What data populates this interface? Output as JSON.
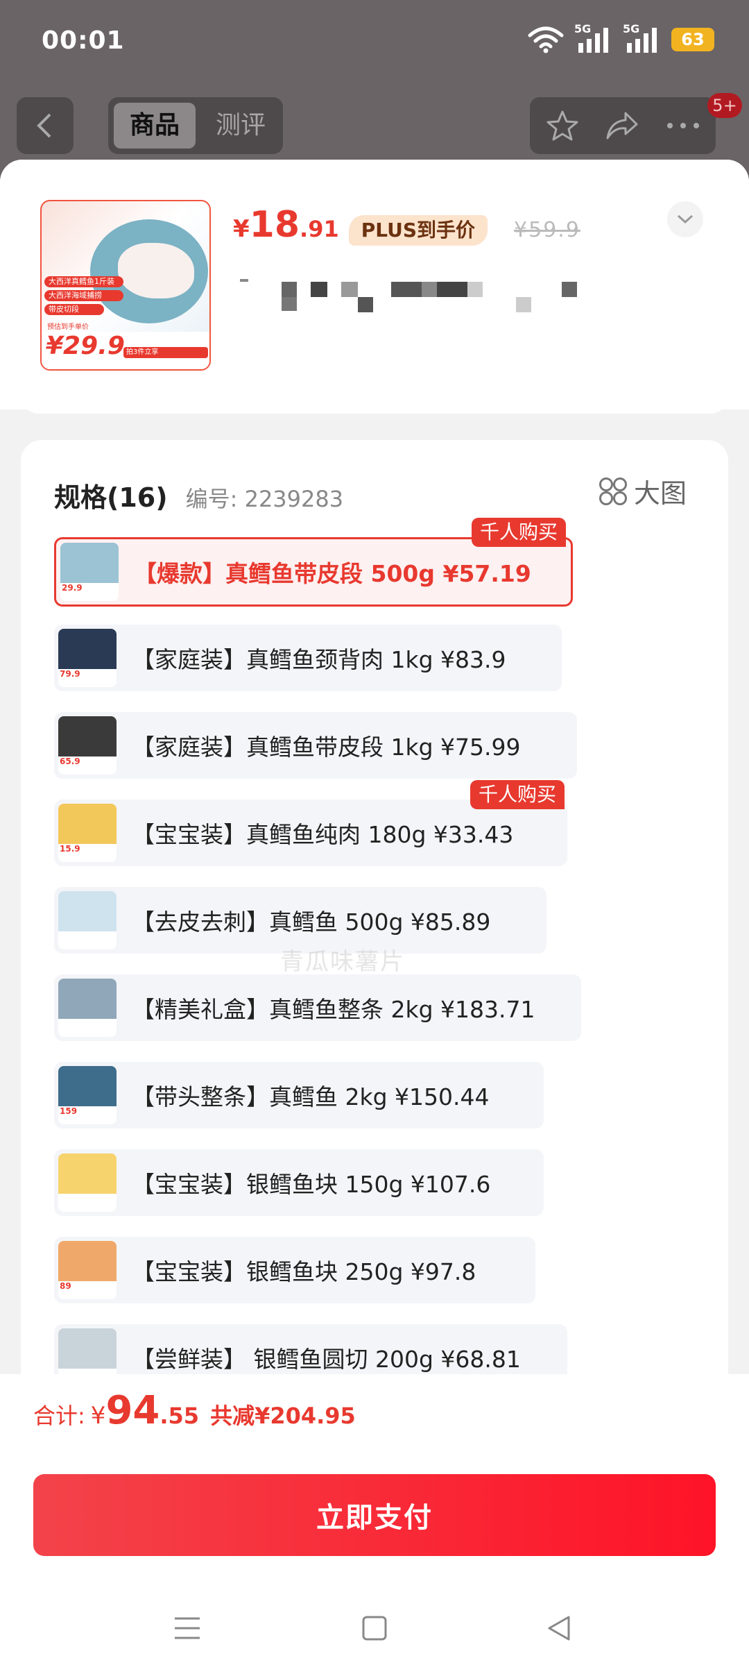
{
  "status_bar": {
    "time": "00:01",
    "signal1_label": "5G",
    "signal2_label": "5G",
    "battery": "63"
  },
  "top_nav": {
    "tab_product": "商品",
    "tab_review": "测评",
    "more_badge": "5+"
  },
  "product": {
    "price_symbol": "¥",
    "price_int": "18",
    "price_dec": ".91",
    "plus_tag": "PLUS到手价",
    "original_price": "¥59.9",
    "thumb_tags": [
      "大西洋真鳕鱼1斤装",
      "大西洋海域捕捞",
      "带皮切段"
    ],
    "thumb_price_label": "预估到手单价",
    "thumb_price": "¥29.9",
    "thumb_promo": "拍3件立享"
  },
  "spec": {
    "title": "规格(16)",
    "code": "编号: 2239283",
    "big_image_label": "大图",
    "options": [
      {
        "label": "【爆款】真鳕鱼带皮段 500g  ¥57.19",
        "selected": true,
        "hot": "千人购买",
        "thumb_color": "#9bc3d3",
        "thumb_price": "29.9"
      },
      {
        "label": "【家庭装】真鳕鱼颈背肉 1kg  ¥83.9",
        "selected": false,
        "hot": "",
        "thumb_color": "#2a3a55",
        "thumb_price": "79.9"
      },
      {
        "label": "【家庭装】真鳕鱼带皮段 1kg  ¥75.99",
        "selected": false,
        "hot": "",
        "thumb_color": "#3b3a3a",
        "thumb_price": "65.9"
      },
      {
        "label": "【宝宝装】真鳕鱼纯肉 180g  ¥33.43",
        "selected": false,
        "hot": "千人购买",
        "thumb_color": "#f3c85a",
        "thumb_price": "15.9"
      },
      {
        "label": "【去皮去刺】真鳕鱼 500g  ¥85.89",
        "selected": false,
        "hot": "",
        "thumb_color": "#cfe3ef",
        "thumb_price": ""
      },
      {
        "label": "【精美礼盒】真鳕鱼整条 2kg  ¥183.71",
        "selected": false,
        "hot": "",
        "thumb_color": "#8fa7b8",
        "thumb_price": ""
      },
      {
        "label": "【带头整条】真鳕鱼 2kg  ¥150.44",
        "selected": false,
        "hot": "",
        "thumb_color": "#3e6d8c",
        "thumb_price": "159"
      },
      {
        "label": "【宝宝装】银鳕鱼块 150g  ¥107.6",
        "selected": false,
        "hot": "",
        "thumb_color": "#f7d36d",
        "thumb_price": ""
      },
      {
        "label": "【宝宝装】银鳕鱼块 250g  ¥97.8",
        "selected": false,
        "hot": "",
        "thumb_color": "#f0a86a",
        "thumb_price": "89"
      },
      {
        "label": "【尝鲜装】 银鳕鱼圆切 200g  ¥68.81",
        "selected": false,
        "hot": "",
        "thumb_color": "#c9d3da",
        "thumb_price": ""
      }
    ]
  },
  "watermark": "青瓜味薯片",
  "footer": {
    "total_label": "合计:",
    "total_sym": "¥",
    "total_int": "94",
    "total_dec": ".55",
    "saved_text": "共减¥204.95",
    "pay_button": "立即支付"
  },
  "colors": {
    "accent": "#e8392f",
    "plus_bg": "#fce3cc",
    "pay_start": "#f3434a",
    "pay_end": "#fe1327"
  }
}
